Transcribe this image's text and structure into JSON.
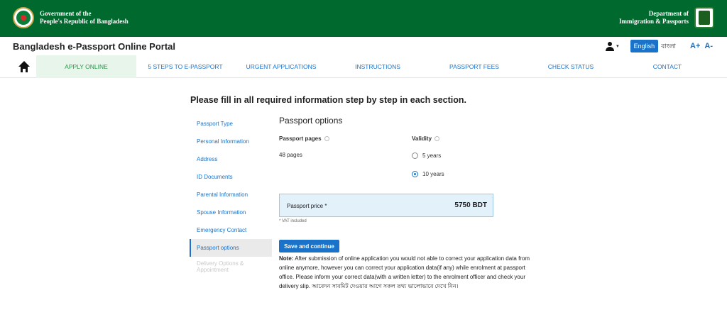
{
  "gov_bar": {
    "left_line1": "Government of the",
    "left_line2": "People's Republic of Bangladesh",
    "right_line1": "Department of",
    "right_line2": "Immigration & Passports"
  },
  "header": {
    "portal_title": "Bangladesh e-Passport Online Portal",
    "lang_english": "English",
    "lang_bangla": "বাংলা",
    "font_increase": "A+",
    "font_decrease": "A-",
    "caret": "▾"
  },
  "nav": {
    "items": [
      {
        "label": "Apply Online"
      },
      {
        "label": "5 Steps to e-Passport"
      },
      {
        "label": "Urgent Applications"
      },
      {
        "label": "Instructions"
      },
      {
        "label": "Passport Fees"
      },
      {
        "label": "Check Status"
      },
      {
        "label": "Contact"
      }
    ]
  },
  "instruction": "Please fill in all required information step by step in each section.",
  "sidebar": {
    "items": [
      {
        "label": "Passport Type"
      },
      {
        "label": "Personal Information"
      },
      {
        "label": "Address"
      },
      {
        "label": "ID Documents"
      },
      {
        "label": "Parental Information"
      },
      {
        "label": "Spouse Information"
      },
      {
        "label": "Emergency Contact"
      },
      {
        "label": "Passport options"
      },
      {
        "label": "Delivery Options & Appointment"
      }
    ]
  },
  "form": {
    "section_title": "Passport options",
    "pages_label": "Passport pages",
    "pages_value": "48 pages",
    "validity_label": "Validity",
    "validity_options": [
      {
        "label": "5 years",
        "selected": false
      },
      {
        "label": "10 years",
        "selected": true
      }
    ],
    "price_label": "Passport price *",
    "price_value": "5750 BDT",
    "vat_note": "* VAT included",
    "save_button": "Save and continue",
    "note_bold": "Note:",
    "note_text": "After submission of online application you would not able to correct your application data from online anymore, however you can correct your application data(if any) while enrolment at passport office. Please inform your correct data(with a written letter) to the enrolment officer and check your delivery slip. আবেদন সাবমিট দেওয়ার আগে সকল তথ্য ভালোভাবে দেখে নিন।"
  },
  "colors": {
    "gov_green": "#006a2e",
    "accent_blue": "#1a73c8",
    "active_nav_green": "#1e9c44"
  }
}
